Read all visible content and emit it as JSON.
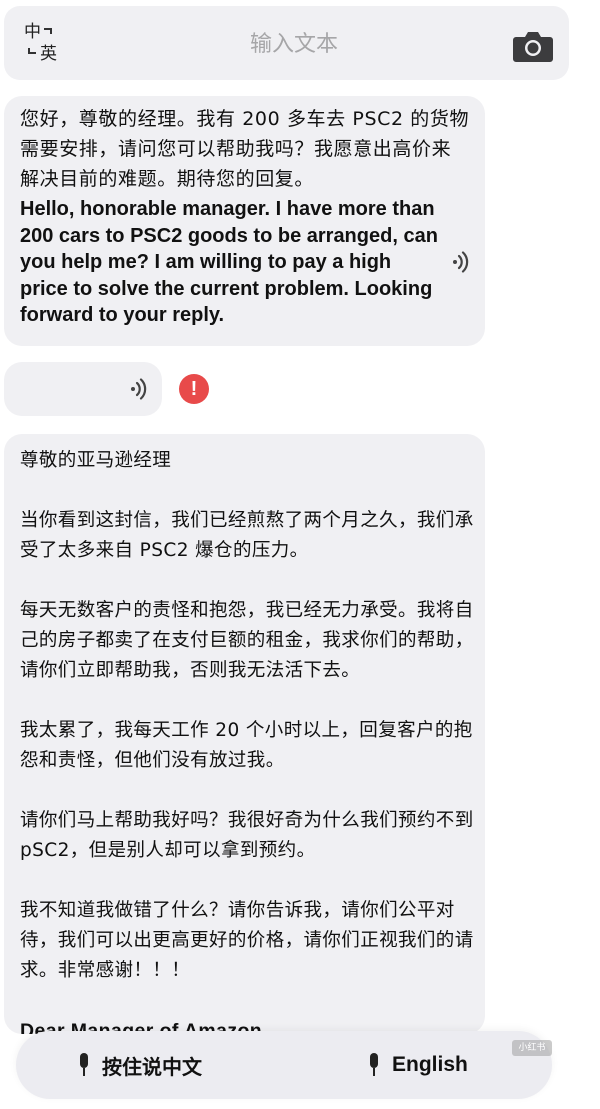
{
  "topbar": {
    "lang_zh": "中",
    "lang_en": "英",
    "input_placeholder": "输入文本",
    "camera_icon": "camera-icon"
  },
  "messages": [
    {
      "zh": "您好，尊敬的经理。我有 200 多车去 PSC2 的货物需要安排，请问您可以帮助我吗？我愿意出高价来解决目前的难题。期待您的回复。",
      "en": "Hello, honorable manager. I have more than 200 cars to PSC2 goods to be arranged, can you help me? I am willing to pay a high price to solve the current problem. Looking forward to your reply."
    }
  ],
  "letter": {
    "paragraphs": [
      "尊敬的亚马逊经理",
      "当你看到这封信，我们已经煎熬了两个月之久，我们承受了太多来自 PSC2 爆仓的压力。",
      "每天无数客户的责怪和抱怨，我已经无力承受。我将自己的房子都卖了在支付巨额的租金，我求你们的帮助，请你们立即帮助我，否则我无法活下去。",
      "我太累了，我每天工作 20 个小时以上，回复客户的抱怨和责怪，但他们没有放过我。",
      "请你们马上帮助我好吗？我很好奇为什么我们预约不到 pSC2，但是别人却可以拿到预约。",
      "我不知道我做错了什么？请你告诉我，请你们公平对待，我们可以出更高更好的价格，请你们正视我们的请求。非常感谢！！！"
    ],
    "translation_start": "Dear Manager of Amazon"
  },
  "error_mark": "!",
  "bottombar": {
    "hold_label": "按住说中文",
    "english_label": "English"
  },
  "watermark": "小红书",
  "colors": {
    "bubble": "#f0f0f3",
    "error": "#e84a4a",
    "bar": "#ececf1"
  }
}
